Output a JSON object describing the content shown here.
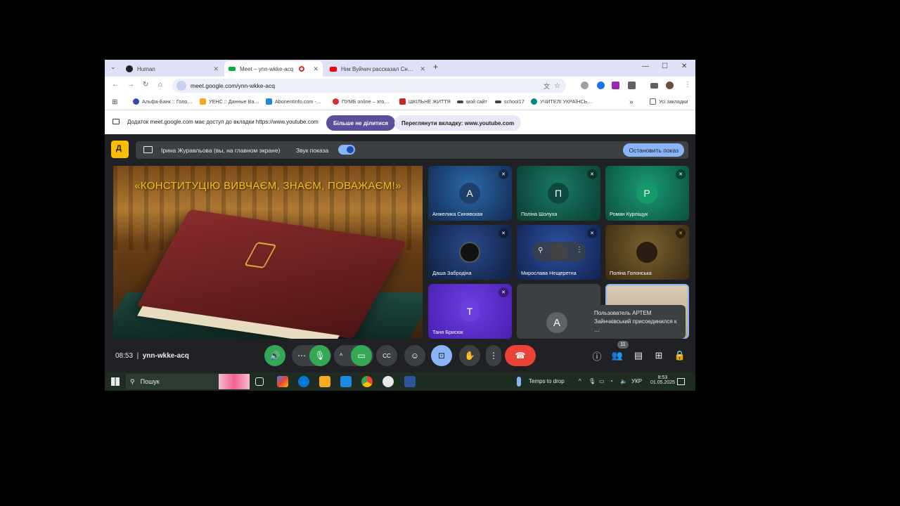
{
  "tabs": [
    {
      "title": "Human",
      "favicon_color": "#202124"
    },
    {
      "title": "Meet – ynn-wkke-acq",
      "favicon_color": "#00ac47"
    },
    {
      "title": "Ник Вуйчич рассказал Сн…",
      "favicon_color": "#ff0000"
    }
  ],
  "address": {
    "url": "meet.google.com/ynn-wkke-acq"
  },
  "bookmarks": [
    {
      "label": "Альфа-Банк :: Голо…",
      "color": "#3949ab"
    },
    {
      "label": "УЕНС :: Данные Ва…",
      "color": "#f9a825"
    },
    {
      "label": "AbonentInfo.com -…",
      "color": "#1e88e5"
    },
    {
      "label": "ПУМБ online – это…",
      "color": "#d32f2f"
    },
    {
      "label": "ШКІЛЬНЕ ЖИТТЯ",
      "color": "#c62828"
    },
    {
      "label": "мой сайт",
      "color": "#424242"
    },
    {
      "label": "school17",
      "color": "#424242"
    },
    {
      "label": "УЧИТЕЛІ УКРАЇНСЬ…",
      "color": "#00897b"
    },
    {
      "label": "Усі закладки",
      "color": "#5f6368"
    }
  ],
  "infobar": {
    "message": "Додаток meet.google.com має доступ до вкладки https://www.youtube.com",
    "stop_sharing": "Більше не ділитися",
    "view_tab": "Переглянути вкладку: www.youtube.com"
  },
  "presenting": {
    "label": "Ірина Журавльова (вы, на главном экране)",
    "audio_label": "Звук показа",
    "stop_button": "Остановить показ"
  },
  "slide": {
    "title": "«КОНСТИТУЦІЮ ВИВЧАЄМ, ЗНАЄМ, ПОВАЖАЄМ!»"
  },
  "participants": [
    {
      "name": "Анжелика Синявская",
      "initial": "А",
      "bg": "#1a4d8c",
      "avatar_bg": "#1f3f6b"
    },
    {
      "name": "Поліна Шолуха",
      "initial": "П",
      "bg": "#0f5c4c",
      "avatar_bg": "#0d4a3d"
    },
    {
      "name": "Роман Курліщук",
      "initial": "Р",
      "bg": "#127a5c",
      "avatar_bg": "#159a6a"
    },
    {
      "name": "Даша Забродіна",
      "initial": "",
      "bg": "#1b2f5c",
      "avatar_bg": "#111"
    },
    {
      "name": "Мирослава Нещеретна",
      "initial": "",
      "bg": "#1b3770",
      "avatar_bg": "#333"
    },
    {
      "name": "Поліна Голонська",
      "initial": "",
      "bg": "#5a4520",
      "avatar_bg": "#2a1e12"
    },
    {
      "name": "Таня Брисюк",
      "initial": "Т",
      "bg": "#5b2ad6",
      "avatar_bg": "#6a3fe0"
    }
  ],
  "toast": {
    "initial": "А",
    "text": "Пользователь АРТЕМ Зайнчківський присоединился к …"
  },
  "meeting": {
    "time": "08:53",
    "code": "ynn-wkke-acq",
    "participant_count": "11"
  },
  "taskbar": {
    "search_placeholder": "Пошук",
    "weather": "Temps to drop",
    "lang": "УКР",
    "time": "8:53",
    "date": "01.05.2025"
  }
}
